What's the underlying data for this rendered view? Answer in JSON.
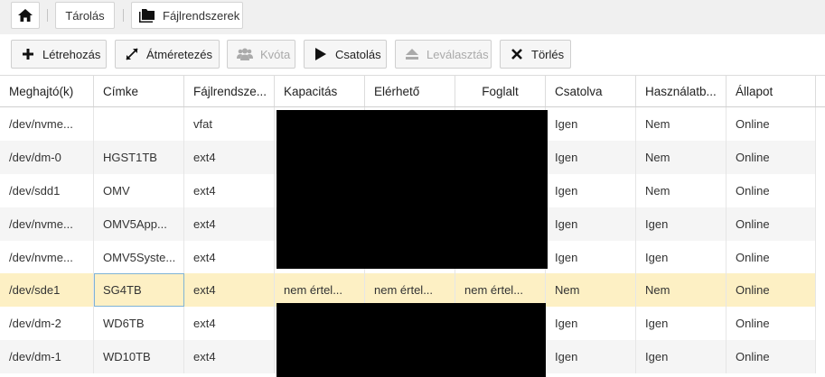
{
  "breadcrumb": {
    "home_icon": "home-icon",
    "storage_label": "Tárolás",
    "filesystems_icon": "folder-icon",
    "filesystems_label": "Fájlrendszerek"
  },
  "toolbar": {
    "create_label": "Létrehozás",
    "resize_label": "Átméretezés",
    "quota_label": "Kvóta",
    "mount_label": "Csatolás",
    "unmount_label": "Leválasztás",
    "delete_label": "Törlés"
  },
  "table": {
    "columns": [
      "Meghajtó(k)",
      "Címke",
      "Fájlrendsze...",
      "Kapacitás",
      "Elérhető",
      "Foglalt",
      "Csatolva",
      "Használatb...",
      "Állapot"
    ],
    "rows": [
      [
        "/dev/nvme...",
        "",
        "vfat",
        "",
        "",
        "",
        "Igen",
        "Nem",
        "Online"
      ],
      [
        "/dev/dm-0",
        "HGST1TB",
        "ext4",
        "",
        "",
        "",
        "Igen",
        "Nem",
        "Online"
      ],
      [
        "/dev/sdd1",
        "OMV",
        "ext4",
        "",
        "",
        "",
        "Igen",
        "Nem",
        "Online"
      ],
      [
        "/dev/nvme...",
        "OMV5App...",
        "ext4",
        "",
        "",
        "",
        "Igen",
        "Igen",
        "Online"
      ],
      [
        "/dev/nvme...",
        "OMV5Syste...",
        "ext4",
        "",
        "",
        "",
        "Igen",
        "Igen",
        "Online"
      ],
      [
        "/dev/sde1",
        "SG4TB",
        "ext4",
        "nem értel...",
        "nem értel...",
        "nem értel...",
        "Nem",
        "Nem",
        "Online"
      ],
      [
        "/dev/dm-2",
        "WD6TB",
        "ext4",
        "",
        "",
        "",
        "Igen",
        "Igen",
        "Online"
      ],
      [
        "/dev/dm-1",
        "WD10TB",
        "ext4",
        "",
        "",
        "",
        "Igen",
        "Igen",
        "Online"
      ]
    ]
  }
}
